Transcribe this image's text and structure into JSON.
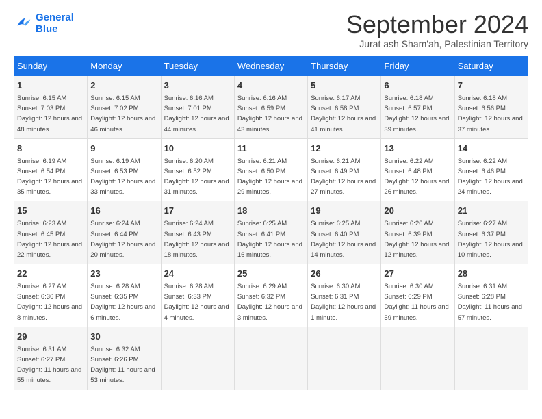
{
  "header": {
    "logo_line1": "General",
    "logo_line2": "Blue",
    "month_title": "September 2024",
    "subtitle": "Jurat ash Sham'ah, Palestinian Territory"
  },
  "days_of_week": [
    "Sunday",
    "Monday",
    "Tuesday",
    "Wednesday",
    "Thursday",
    "Friday",
    "Saturday"
  ],
  "weeks": [
    [
      {
        "day": "1",
        "sunrise": "6:15 AM",
        "sunset": "7:03 PM",
        "daylight": "12 hours and 48 minutes."
      },
      {
        "day": "2",
        "sunrise": "6:15 AM",
        "sunset": "7:02 PM",
        "daylight": "12 hours and 46 minutes."
      },
      {
        "day": "3",
        "sunrise": "6:16 AM",
        "sunset": "7:01 PM",
        "daylight": "12 hours and 44 minutes."
      },
      {
        "day": "4",
        "sunrise": "6:16 AM",
        "sunset": "6:59 PM",
        "daylight": "12 hours and 43 minutes."
      },
      {
        "day": "5",
        "sunrise": "6:17 AM",
        "sunset": "6:58 PM",
        "daylight": "12 hours and 41 minutes."
      },
      {
        "day": "6",
        "sunrise": "6:18 AM",
        "sunset": "6:57 PM",
        "daylight": "12 hours and 39 minutes."
      },
      {
        "day": "7",
        "sunrise": "6:18 AM",
        "sunset": "6:56 PM",
        "daylight": "12 hours and 37 minutes."
      }
    ],
    [
      {
        "day": "8",
        "sunrise": "6:19 AM",
        "sunset": "6:54 PM",
        "daylight": "12 hours and 35 minutes."
      },
      {
        "day": "9",
        "sunrise": "6:19 AM",
        "sunset": "6:53 PM",
        "daylight": "12 hours and 33 minutes."
      },
      {
        "day": "10",
        "sunrise": "6:20 AM",
        "sunset": "6:52 PM",
        "daylight": "12 hours and 31 minutes."
      },
      {
        "day": "11",
        "sunrise": "6:21 AM",
        "sunset": "6:50 PM",
        "daylight": "12 hours and 29 minutes."
      },
      {
        "day": "12",
        "sunrise": "6:21 AM",
        "sunset": "6:49 PM",
        "daylight": "12 hours and 27 minutes."
      },
      {
        "day": "13",
        "sunrise": "6:22 AM",
        "sunset": "6:48 PM",
        "daylight": "12 hours and 26 minutes."
      },
      {
        "day": "14",
        "sunrise": "6:22 AM",
        "sunset": "6:46 PM",
        "daylight": "12 hours and 24 minutes."
      }
    ],
    [
      {
        "day": "15",
        "sunrise": "6:23 AM",
        "sunset": "6:45 PM",
        "daylight": "12 hours and 22 minutes."
      },
      {
        "day": "16",
        "sunrise": "6:24 AM",
        "sunset": "6:44 PM",
        "daylight": "12 hours and 20 minutes."
      },
      {
        "day": "17",
        "sunrise": "6:24 AM",
        "sunset": "6:43 PM",
        "daylight": "12 hours and 18 minutes."
      },
      {
        "day": "18",
        "sunrise": "6:25 AM",
        "sunset": "6:41 PM",
        "daylight": "12 hours and 16 minutes."
      },
      {
        "day": "19",
        "sunrise": "6:25 AM",
        "sunset": "6:40 PM",
        "daylight": "12 hours and 14 minutes."
      },
      {
        "day": "20",
        "sunrise": "6:26 AM",
        "sunset": "6:39 PM",
        "daylight": "12 hours and 12 minutes."
      },
      {
        "day": "21",
        "sunrise": "6:27 AM",
        "sunset": "6:37 PM",
        "daylight": "12 hours and 10 minutes."
      }
    ],
    [
      {
        "day": "22",
        "sunrise": "6:27 AM",
        "sunset": "6:36 PM",
        "daylight": "12 hours and 8 minutes."
      },
      {
        "day": "23",
        "sunrise": "6:28 AM",
        "sunset": "6:35 PM",
        "daylight": "12 hours and 6 minutes."
      },
      {
        "day": "24",
        "sunrise": "6:28 AM",
        "sunset": "6:33 PM",
        "daylight": "12 hours and 4 minutes."
      },
      {
        "day": "25",
        "sunrise": "6:29 AM",
        "sunset": "6:32 PM",
        "daylight": "12 hours and 3 minutes."
      },
      {
        "day": "26",
        "sunrise": "6:30 AM",
        "sunset": "6:31 PM",
        "daylight": "12 hours and 1 minute."
      },
      {
        "day": "27",
        "sunrise": "6:30 AM",
        "sunset": "6:29 PM",
        "daylight": "11 hours and 59 minutes."
      },
      {
        "day": "28",
        "sunrise": "6:31 AM",
        "sunset": "6:28 PM",
        "daylight": "11 hours and 57 minutes."
      }
    ],
    [
      {
        "day": "29",
        "sunrise": "6:31 AM",
        "sunset": "6:27 PM",
        "daylight": "11 hours and 55 minutes."
      },
      {
        "day": "30",
        "sunrise": "6:32 AM",
        "sunset": "6:26 PM",
        "daylight": "11 hours and 53 minutes."
      },
      null,
      null,
      null,
      null,
      null
    ]
  ]
}
